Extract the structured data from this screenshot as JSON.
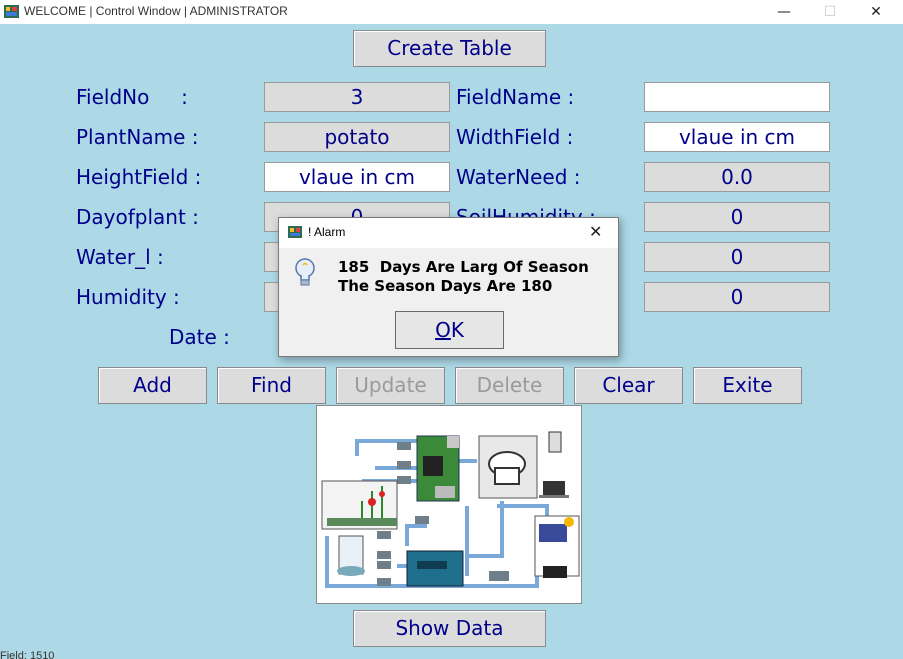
{
  "window": {
    "title": "WELCOME | Control Window | ADMINISTRATOR",
    "minimize": "—",
    "maximize": "☐",
    "close": "✕"
  },
  "buttons": {
    "create_table": "Create Table",
    "add": "Add",
    "find": "Find",
    "update": "Update",
    "delete": "Delete",
    "clear": "Clear",
    "exit": "Exite",
    "show_data": "Show Data"
  },
  "form": {
    "field_no_label": "FieldNo     :",
    "field_no_value": "3",
    "field_name_label": "FieldName :",
    "field_name_value": "",
    "plant_name_label": "PlantName :",
    "plant_name_value": "potato",
    "width_field_label": "WidthField :",
    "width_field_value": "vlaue in cm",
    "height_field_label": "HeightField :",
    "height_field_value": "vlaue in cm",
    "water_need_label": "WaterNeed :",
    "water_need_value": "0.0",
    "day_of_plant_label": "Dayofplant :",
    "day_of_plant_value": "0",
    "soil_humidity_label": "SoilHumidity :",
    "soil_humidity_value": "0",
    "water_l_label": "Water_l :",
    "right_row5_value": "0",
    "humidity_label": "Humidity :",
    "right_row6_value": "0",
    "date_label": "Date :"
  },
  "dialog": {
    "title": "! Alarm",
    "close": "✕",
    "message_line1": "185  Days Are Larg Of Season",
    "message_line2": "The Season Days Are 180",
    "ok_underlined": "O",
    "ok_rest": "K",
    "icon": "lightbulb-info-icon"
  },
  "status": {
    "text": "Field: 1510"
  },
  "diagram": {
    "icon": "iot-irrigation-system-diagram"
  }
}
